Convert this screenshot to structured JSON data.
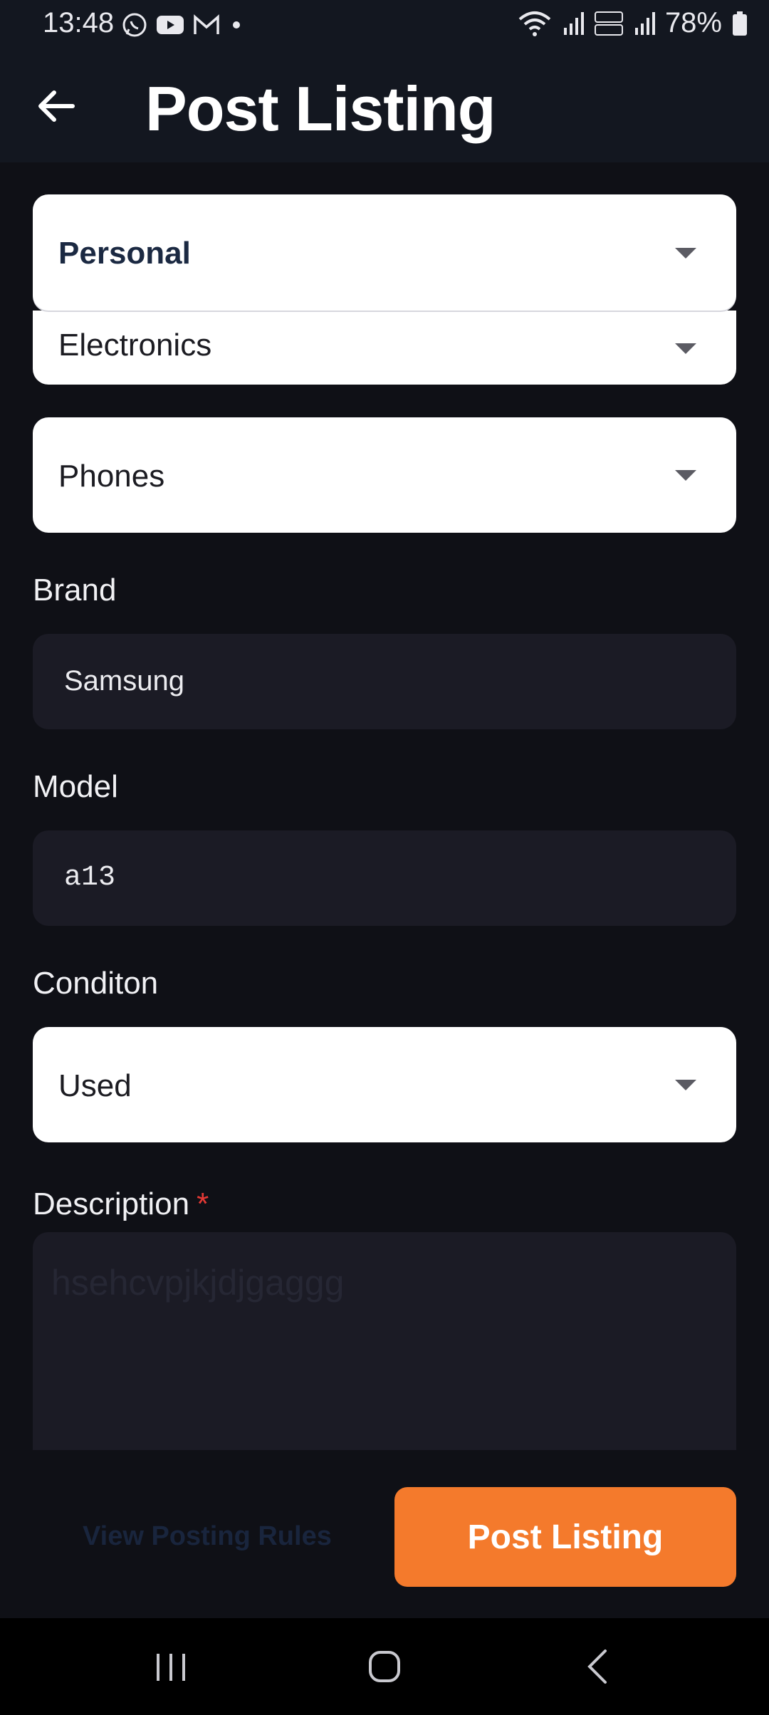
{
  "status_bar": {
    "time": "13:48",
    "battery": "78%",
    "left_icons": [
      "whatsapp-icon",
      "youtube-icon",
      "gmail-icon",
      "dot-icon"
    ],
    "right_icons": [
      "wifi-icon",
      "signal-icon",
      "volte-lte2-icon",
      "signal-icon",
      "battery-icon"
    ]
  },
  "app_bar": {
    "title": "Post Listing",
    "back_icon": "arrow-left-icon"
  },
  "form": {
    "listing_type": "Personal",
    "category": "Electronics",
    "subcategory": "Phones",
    "brand_label": "Brand",
    "brand_value": "Samsung",
    "model_label": "Model",
    "model_value": "a13",
    "condition_label": "Conditon",
    "condition_value": "Used",
    "description_label": "Description",
    "description_required": "*",
    "description_placeholder": "hsehcvpjkjdjgaggg"
  },
  "actions": {
    "rules_link": "View Posting Rules",
    "post_button": "Post Listing"
  },
  "colors": {
    "accent": "#f47a2c",
    "background": "#0f1016",
    "input_bg": "#1b1b25",
    "required": "#e53935"
  }
}
